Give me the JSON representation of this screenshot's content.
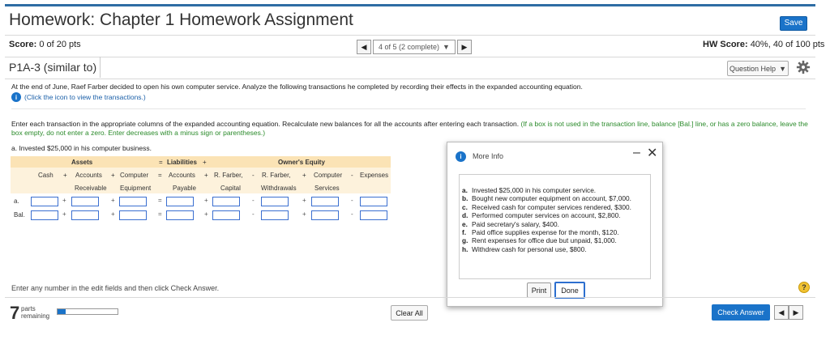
{
  "header": {
    "title": "Homework: Chapter 1 Homework Assignment",
    "save_label": "Save"
  },
  "score": {
    "label": "Score:",
    "value": "0 of 20 pts"
  },
  "hw_score": {
    "label": "HW Score:",
    "value": "40%, 40 of 100 pts"
  },
  "pager": {
    "status": "4 of 5 (2 complete)"
  },
  "question": {
    "id": "P1A-3 (similar to)",
    "help_label": "Question Help",
    "intro": "At the end of June, Raef Farber decided to open his own computer service. Analyze the following transactions he completed by recording their effects in the expanded accounting equation.",
    "click_icon": "(Click the icon to view the transactions.)",
    "instructions_1": "Enter each transaction in the appropriate columns of the expanded accounting equation. Recalculate new balances for all the accounts after entering each transaction.",
    "instructions_green": "(If a box is not used in the transaction line, balance [Bal.] line, or has a zero balance, leave the box empty, do not enter a zero. Enter decreases with a minus sign or parentheses.)",
    "part_a": "a. Invested $25,000 in his computer business."
  },
  "equation": {
    "groups": {
      "assets": "Assets",
      "eq": "=",
      "liabilities": "Liabilities",
      "plus": "+",
      "equity": "Owner's Equity"
    },
    "headers_row1": [
      "Cash",
      "Accounts",
      "Computer",
      "Accounts",
      "R. Farber,",
      "R. Farber,",
      "Computer",
      "Expenses"
    ],
    "headers_row2": [
      "",
      "Receivable",
      "Equipment",
      "Payable",
      "Capital",
      "Withdrawals",
      "Services",
      ""
    ],
    "ops": [
      "+",
      "+",
      "=",
      "+",
      "-",
      "+",
      "-"
    ],
    "row_labels": [
      "a.",
      "Bal."
    ]
  },
  "modal": {
    "title": "More Info",
    "items": [
      {
        "letter": "a.",
        "text": "Invested $25,000 in his computer service."
      },
      {
        "letter": "b.",
        "text": "Bought new computer equipment on account, $7,000."
      },
      {
        "letter": "c.",
        "text": "Received cash for computer services rendered, $300."
      },
      {
        "letter": "d.",
        "text": "Performed computer services on account, $2,800."
      },
      {
        "letter": "e.",
        "text": "Paid secretary's salary, $400."
      },
      {
        "letter": "f.",
        "text": "Paid office supplies expense for the month, $120."
      },
      {
        "letter": "g.",
        "text": "Rent expenses for office due but unpaid, $1,000."
      },
      {
        "letter": "h.",
        "text": "Withdrew cash for personal use, $800."
      }
    ],
    "print_label": "Print",
    "done_label": "Done"
  },
  "footer": {
    "hint": "Enter any number in the edit fields and then click Check Answer.",
    "parts_count": "7",
    "parts_label_1": "parts",
    "parts_label_2": "remaining",
    "progress_fraction": 0.14,
    "clear_all": "Clear All",
    "check_answer": "Check Answer"
  },
  "colors": {
    "accent": "#1a73c9",
    "header_line": "#2e6da4",
    "equation_band": "#fbe3b5"
  },
  "icons": [
    "info-icon",
    "gear-icon",
    "caret-left-icon",
    "caret-right-icon",
    "caret-down-icon",
    "minimize-icon",
    "close-icon",
    "help-icon"
  ]
}
